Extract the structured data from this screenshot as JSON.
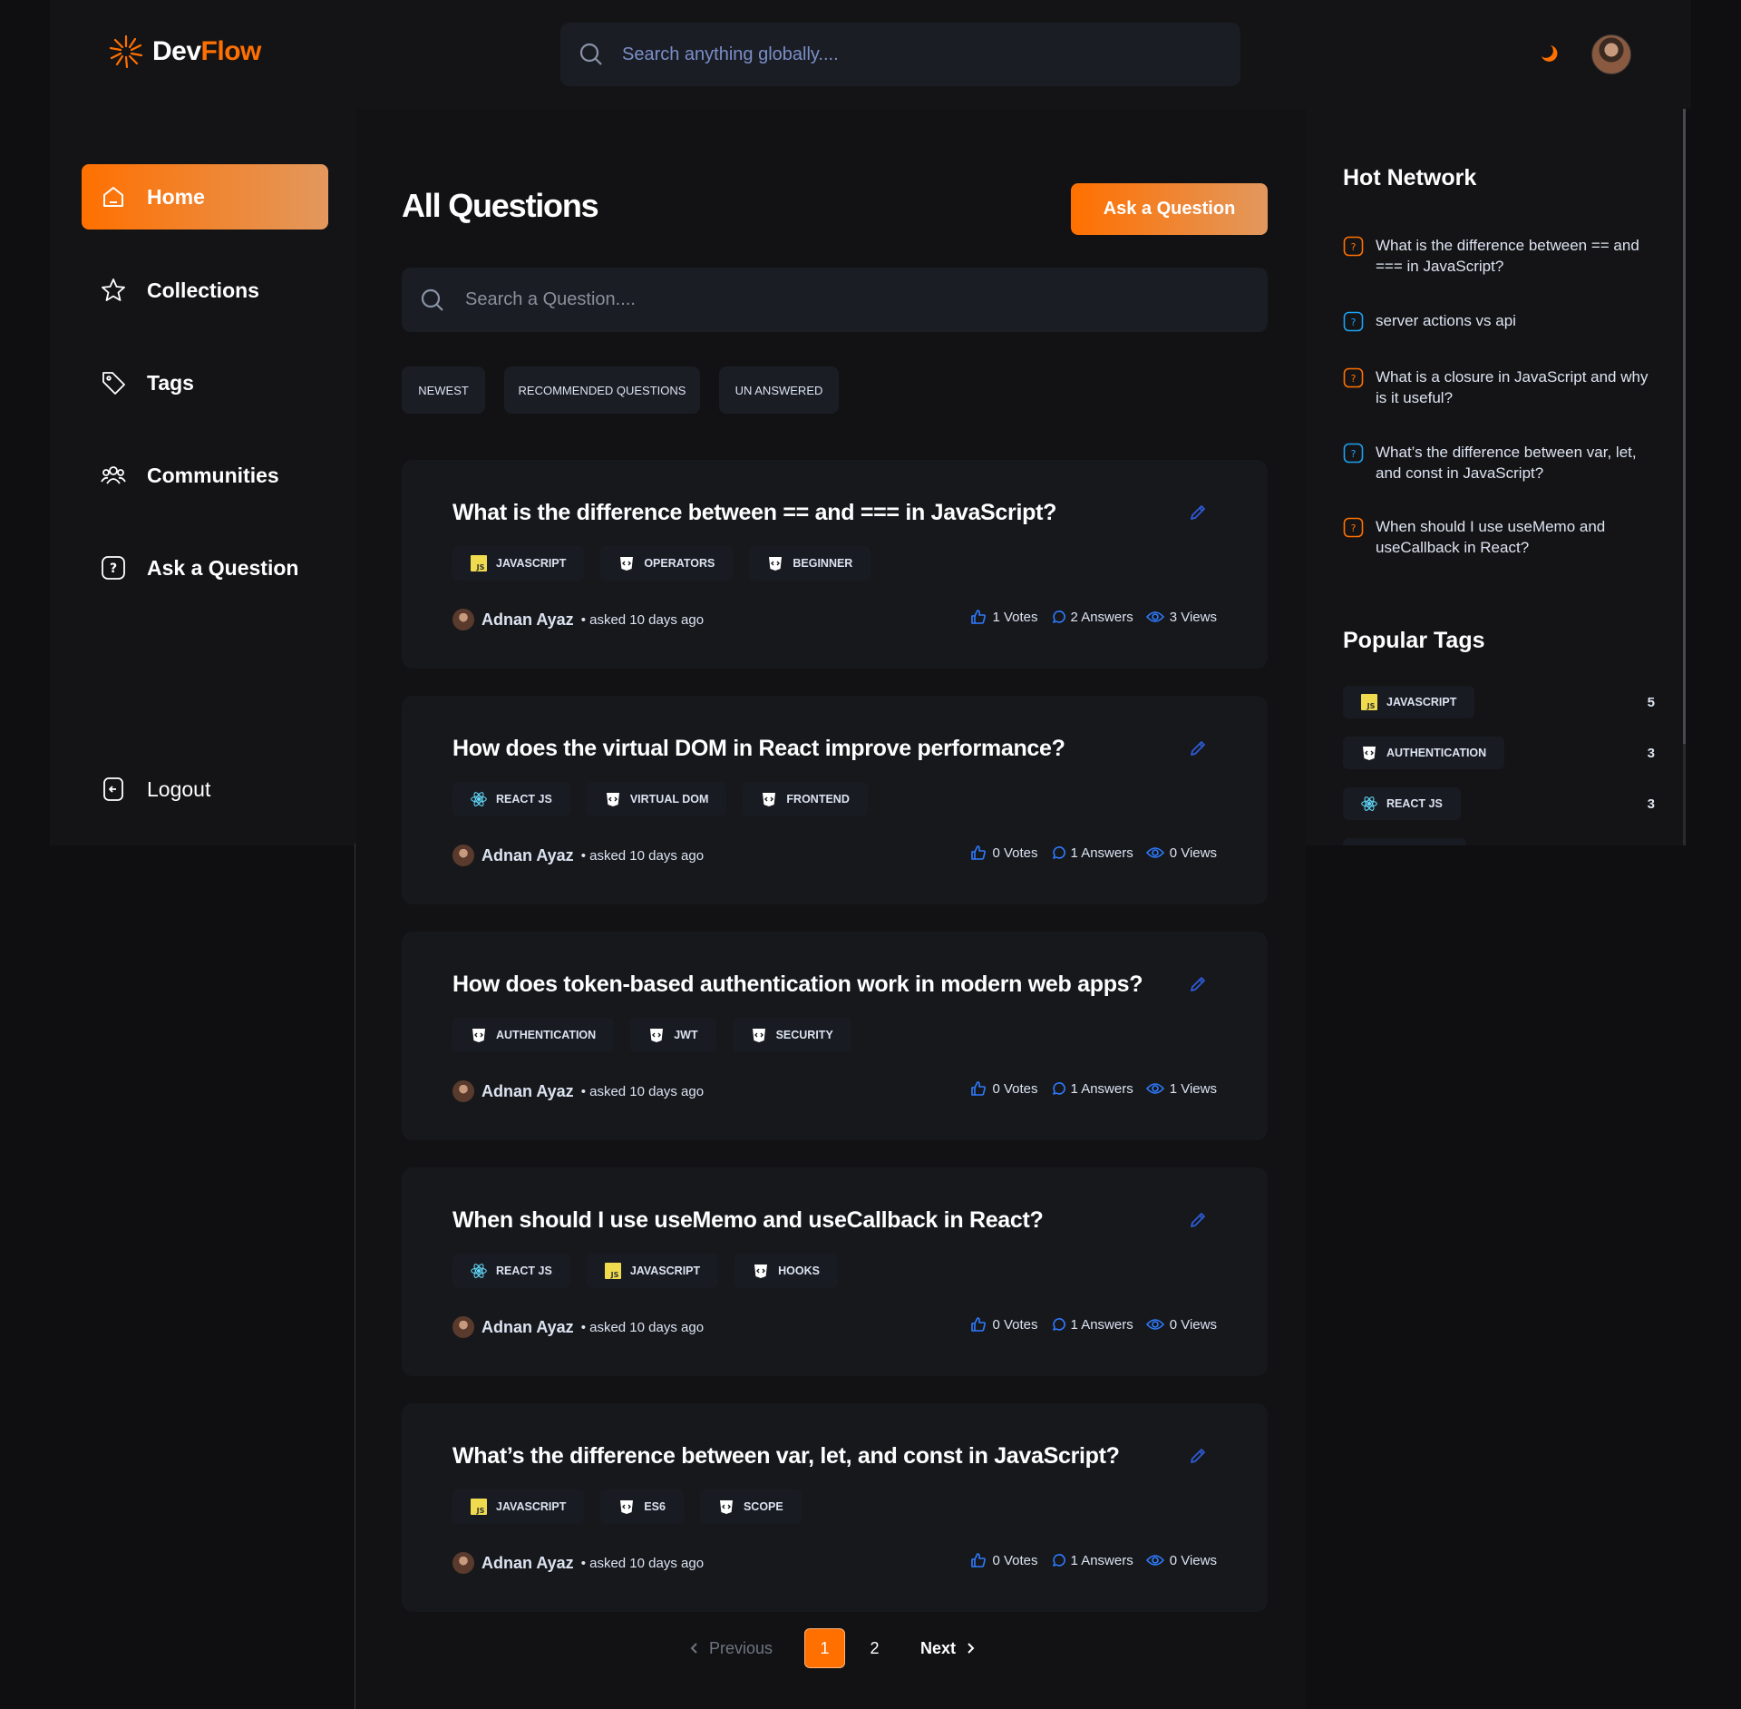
{
  "brand": {
    "name_part1": "Dev",
    "name_part2": "Flow",
    "accent": "#ff7000"
  },
  "global_search": {
    "placeholder": "Search anything globally...."
  },
  "sidebar": {
    "items": [
      {
        "label": "Home",
        "icon": "home-icon",
        "active": true
      },
      {
        "label": "Collections",
        "icon": "star-icon"
      },
      {
        "label": "Tags",
        "icon": "tag-icon"
      },
      {
        "label": "Communities",
        "icon": "users-icon"
      },
      {
        "label": "Ask a Question",
        "icon": "question-icon"
      }
    ],
    "logout_label": "Logout"
  },
  "main": {
    "title": "All Questions",
    "ask_button": "Ask a Question",
    "search_placeholder": "Search a Question....",
    "filters": [
      "NEWEST",
      "RECOMMENDED QUESTIONS",
      "UN ANSWERED"
    ],
    "questions": [
      {
        "title": "What is the difference between == and === in JavaScript?",
        "tags": [
          {
            "label": "JAVASCRIPT",
            "icon": "javascript-icon"
          },
          {
            "label": "OPERATORS",
            "icon": "html-shield-icon"
          },
          {
            "label": "BEGINNER",
            "icon": "html-shield-icon"
          }
        ],
        "author": "Adnan Ayaz",
        "asked": "• asked 10 days ago",
        "votes": "1 Votes",
        "answers": "2 Answers",
        "views": "3 Views"
      },
      {
        "title": "How does the virtual DOM in React improve performance?",
        "tags": [
          {
            "label": "REACT JS",
            "icon": "react-icon"
          },
          {
            "label": "VIRTUAL DOM",
            "icon": "html-shield-icon"
          },
          {
            "label": "FRONTEND",
            "icon": "html-shield-icon"
          }
        ],
        "author": "Adnan Ayaz",
        "asked": "• asked 10 days ago",
        "votes": "0 Votes",
        "answers": "1 Answers",
        "views": "0 Views"
      },
      {
        "title": "How does token-based authentication work in modern web apps?",
        "tags": [
          {
            "label": "AUTHENTICATION",
            "icon": "html-shield-icon"
          },
          {
            "label": "JWT",
            "icon": "html-shield-icon"
          },
          {
            "label": "SECURITY",
            "icon": "html-shield-icon"
          }
        ],
        "author": "Adnan Ayaz",
        "asked": "• asked 10 days ago",
        "votes": "0 Votes",
        "answers": "1 Answers",
        "views": "1 Views"
      },
      {
        "title": "When should I use useMemo and useCallback in React?",
        "tags": [
          {
            "label": "REACT JS",
            "icon": "react-icon"
          },
          {
            "label": "JAVASCRIPT",
            "icon": "javascript-icon"
          },
          {
            "label": "HOOKS",
            "icon": "html-shield-icon"
          }
        ],
        "author": "Adnan Ayaz",
        "asked": "• asked 10 days ago",
        "votes": "0 Votes",
        "answers": "1 Answers",
        "views": "0 Views"
      },
      {
        "title": "What’s the difference between var, let, and const in JavaScript?",
        "tags": [
          {
            "label": "JAVASCRIPT",
            "icon": "javascript-icon"
          },
          {
            "label": "ES6",
            "icon": "html-shield-icon"
          },
          {
            "label": "SCOPE",
            "icon": "html-shield-icon"
          }
        ],
        "author": "Adnan Ayaz",
        "asked": "• asked 10 days ago",
        "votes": "0 Votes",
        "answers": "1 Answers",
        "views": "0 Views"
      }
    ]
  },
  "pagination": {
    "previous": "Previous",
    "pages": [
      "1",
      "2"
    ],
    "current": "1",
    "next": "Next"
  },
  "right_sidebar": {
    "hot_network_title": "Hot Network",
    "hot_network": [
      {
        "text": "What is the difference between == and === in JavaScript?",
        "color": "#ff7000"
      },
      {
        "text": "server actions vs api",
        "color": "#1da1f2"
      },
      {
        "text": "What is a closure in JavaScript and why is it useful?",
        "color": "#ff7000"
      },
      {
        "text": "What’s the difference between var, let, and const in JavaScript?",
        "color": "#1da1f2"
      },
      {
        "text": "When should I use useMemo and useCallback in React?",
        "color": "#ff7000"
      }
    ],
    "popular_tags_title": "Popular Tags",
    "popular_tags": [
      {
        "label": "JAVASCRIPT",
        "count": "5",
        "icon": "javascript-icon"
      },
      {
        "label": "AUTHENTICATION",
        "count": "3",
        "icon": "html-shield-icon"
      },
      {
        "label": "REACT JS",
        "count": "3",
        "icon": "react-icon"
      }
    ]
  }
}
